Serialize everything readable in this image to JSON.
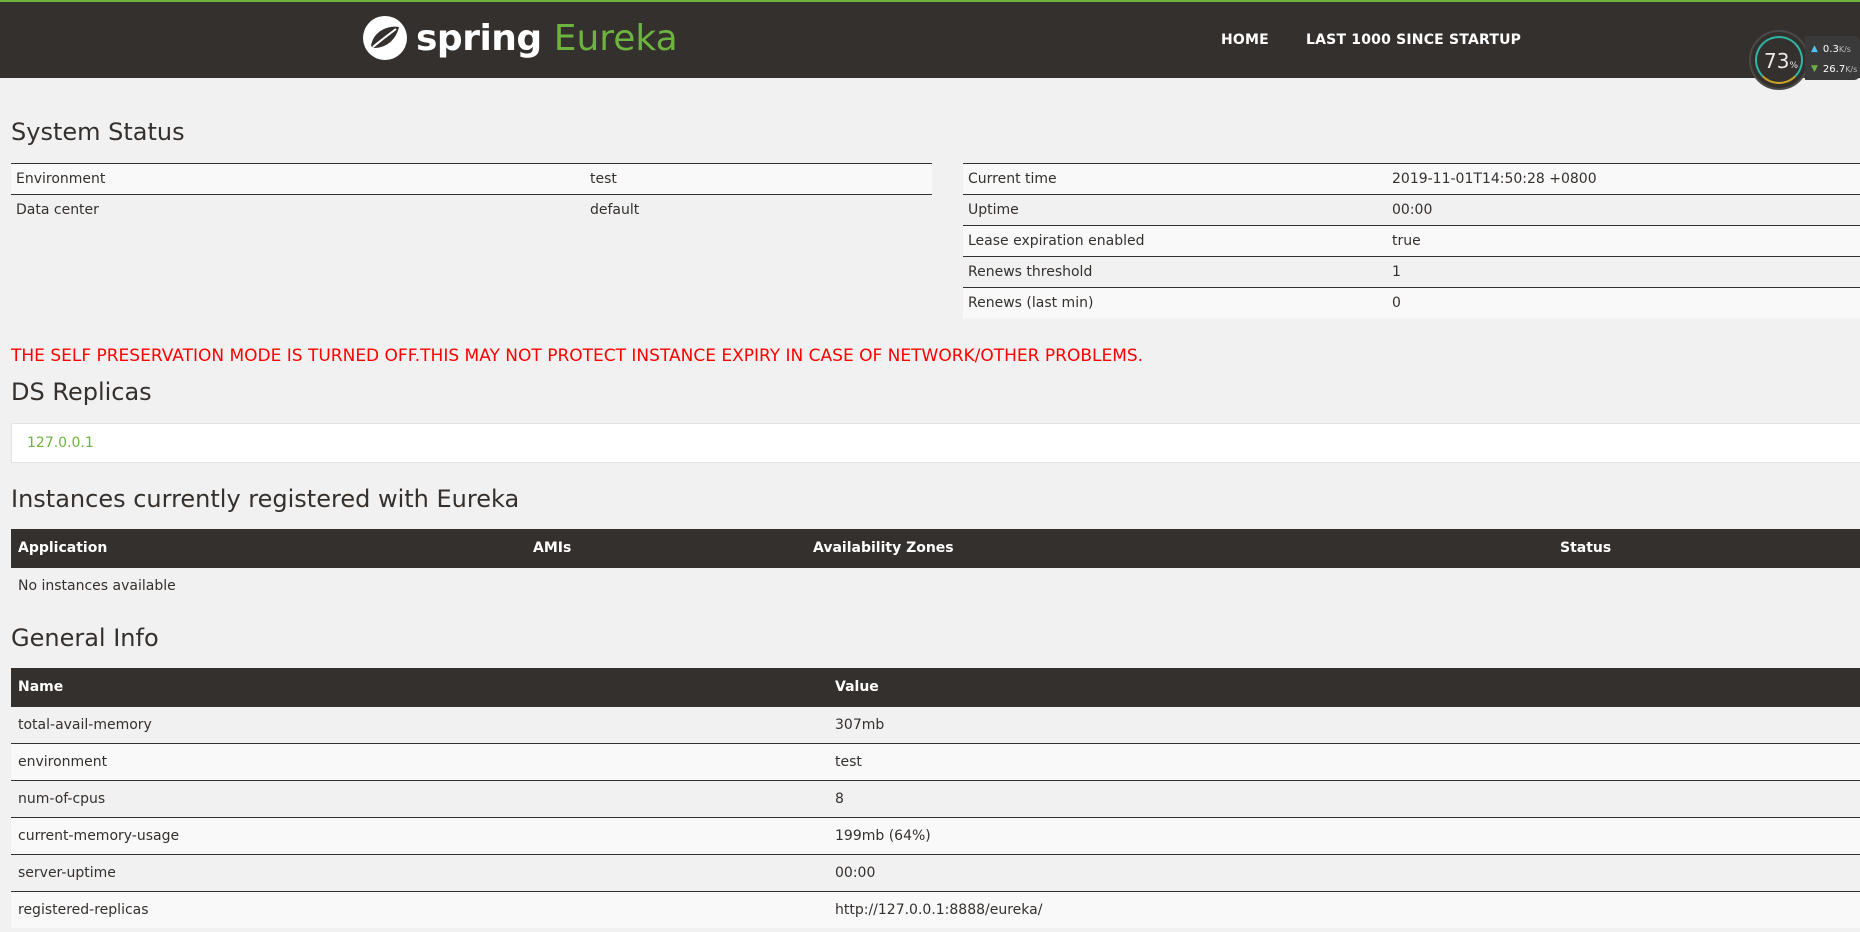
{
  "header": {
    "brand_spring": "spring",
    "brand_eureka": "Eureka",
    "nav": [
      "HOME",
      "LAST 1000 SINCE STARTUP"
    ],
    "colors": {
      "bar": "#34302d",
      "accent": "#6db33f"
    }
  },
  "net_widget": {
    "cpu_percent": "73",
    "percent_sign": "%",
    "upload": "0.3",
    "download": "26.7",
    "unit": "K/s"
  },
  "system_status": {
    "title": "System Status",
    "left": [
      {
        "key": "Environment",
        "value": "test"
      },
      {
        "key": "Data center",
        "value": "default"
      }
    ],
    "right": [
      {
        "key": "Current time",
        "value": "2019-11-01T14:50:28 +0800"
      },
      {
        "key": "Uptime",
        "value": "00:00"
      },
      {
        "key": "Lease expiration enabled",
        "value": "true"
      },
      {
        "key": "Renews threshold",
        "value": "1"
      },
      {
        "key": "Renews (last min)",
        "value": "0"
      }
    ]
  },
  "warning": "THE SELF PRESERVATION MODE IS TURNED OFF.THIS MAY NOT PROTECT INSTANCE EXPIRY IN CASE OF NETWORK/OTHER PROBLEMS.",
  "ds_replicas": {
    "title": "DS Replicas",
    "items": [
      "127.0.0.1"
    ]
  },
  "instances": {
    "title": "Instances currently registered with Eureka",
    "columns": [
      "Application",
      "AMIs",
      "Availability Zones",
      "Status"
    ],
    "empty_text": "No instances available"
  },
  "general_info": {
    "title": "General Info",
    "columns": [
      "Name",
      "Value"
    ],
    "rows": [
      {
        "name": "total-avail-memory",
        "value": "307mb"
      },
      {
        "name": "environment",
        "value": "test"
      },
      {
        "name": "num-of-cpus",
        "value": "8"
      },
      {
        "name": "current-memory-usage",
        "value": "199mb (64%)"
      },
      {
        "name": "server-uptime",
        "value": "00:00"
      },
      {
        "name": "registered-replicas",
        "value": "http://127.0.0.1:8888/eureka/"
      }
    ]
  }
}
